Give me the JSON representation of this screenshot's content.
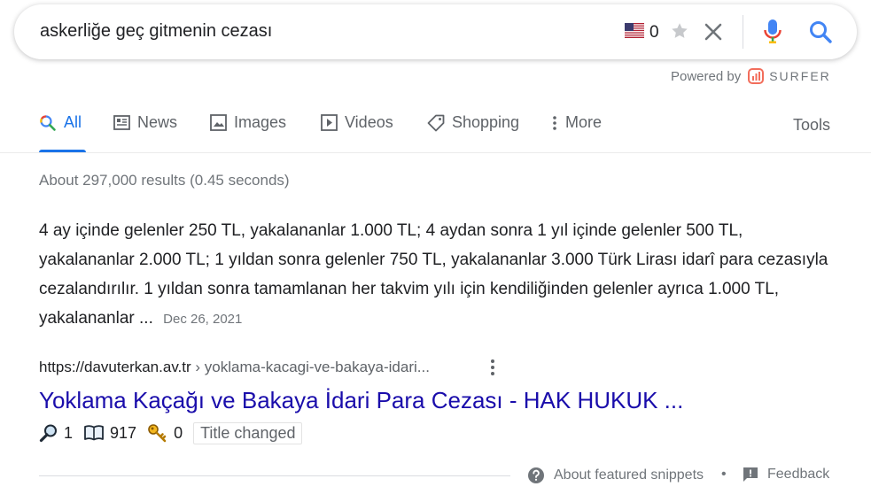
{
  "search": {
    "query": "askerliğe geç gitmenin cezası",
    "flag_count": "0"
  },
  "extension": {
    "powered_by": "Powered by",
    "brand": "SURFER"
  },
  "tabs": [
    {
      "label": "All",
      "icon": "search-icon",
      "active": true
    },
    {
      "label": "News",
      "icon": "news-icon"
    },
    {
      "label": "Images",
      "icon": "image-icon"
    },
    {
      "label": "Videos",
      "icon": "video-icon"
    },
    {
      "label": "Shopping",
      "icon": "tag-icon"
    },
    {
      "label": "More",
      "icon": "more-vertical-icon"
    }
  ],
  "tools_label": "Tools",
  "result_stats": "About 297,000 results (0.45 seconds)",
  "featured_snippet": {
    "text": "4 ay içinde gelenler 250 TL, yakalananlar 1.000 TL; 4 aydan sonra 1 yıl içinde gelenler 500 TL, yakalananlar 2.000 TL; 1 yıldan sonra gelenler 750 TL, yakalananlar 3.000 Türk Lirası idarî para cezasıyla cezalandırılır. 1 yıldan sonra tamamlanan her takvim yılı için kendiliğinden gelenler ayrıca 1.000 TL, yakalananlar ...",
    "date": "Dec 26, 2021"
  },
  "result": {
    "domain": "https://davuterkan.av.tr",
    "path": " › yoklama-kacagi-ve-bakaya-idari...",
    "title": "Yoklama Kaçağı ve Bakaya İdari Para Cezası - HAK HUKUK ..."
  },
  "metrics": {
    "search_count": "1",
    "book_count": "917",
    "key_count": "0",
    "title_changed": "Title changed"
  },
  "footer": {
    "about": "About featured snippets",
    "bullet": "•",
    "feedback": "Feedback"
  },
  "colors": {
    "link": "#1a0dab",
    "accent": "#1a73e8",
    "muted": "#70757a",
    "surfer": "#f26d5b"
  }
}
